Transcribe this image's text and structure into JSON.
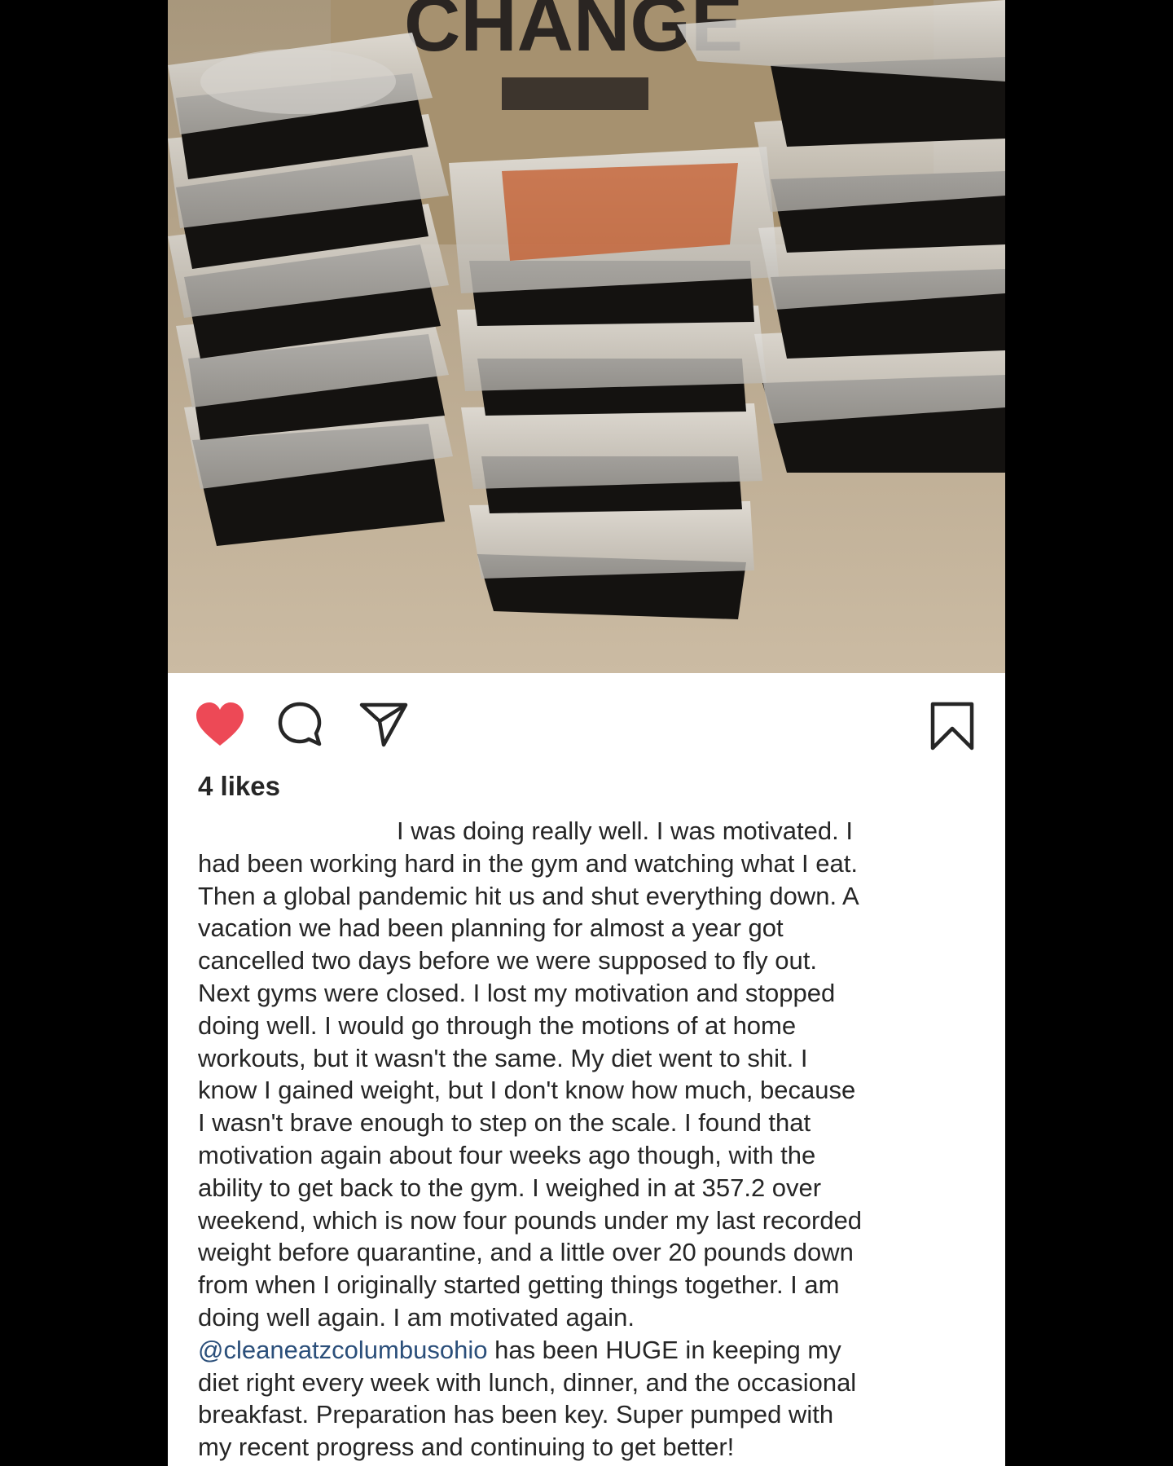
{
  "photo": {
    "description_icon": "meal-prep-containers-photo",
    "background_sign_text": "CHANGE"
  },
  "actions": {
    "like_icon": "heart-icon",
    "comment_icon": "comment-icon",
    "share_icon": "paper-plane-icon",
    "save_icon": "bookmark-icon",
    "like_color": "#ed4956",
    "liked": true
  },
  "likes": "4 likes",
  "caption": {
    "lines": [
      "I was doing really well. I was motivated. I",
      "had been working hard in the gym and watching what I eat.",
      "Then a global pandemic hit us and shut everything down. A",
      "vacation we had been planning for almost a year got",
      "cancelled two days before we were supposed to fly out.",
      "Next gyms were closed. I lost my motivation and stopped",
      "doing well. I would go through the motions of at home",
      "workouts, but it wasn't the same. My diet went to shit. I",
      "know I gained weight, but I don't know how much, because",
      "I wasn't brave enough to step on the scale. I found that",
      "motivation again about four weeks ago though, with the",
      "ability to get back to the gym. I weighed in at 357.2 over",
      "weekend, which is now four pounds under my last recorded",
      "weight before quarantine, and a little over 20 pounds down",
      "from when I originally started getting things together. I am",
      "doing well again. I am motivated again."
    ],
    "mention": "@cleaneatzcolumbusohio",
    "mention_rest": " has been HUGE in keeping my",
    "tail_lines": [
      "diet right every week with lunch, dinner, and the occasional",
      "breakfast. Preparation has been key. Super pumped with",
      "my recent progress and continuing to get better!"
    ]
  }
}
